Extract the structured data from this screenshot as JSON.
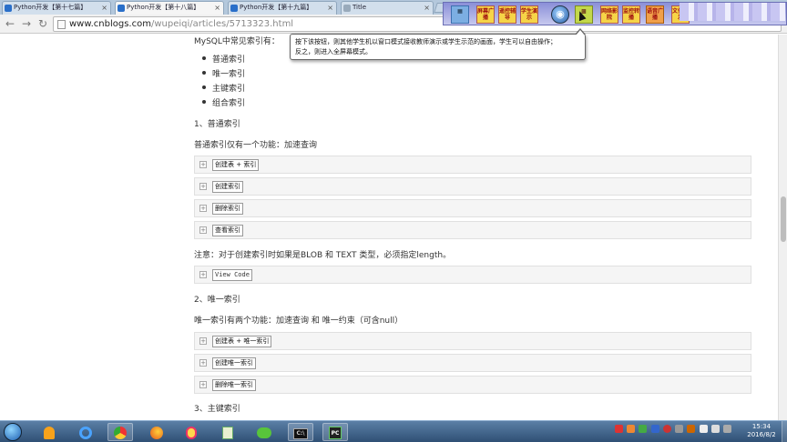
{
  "browser": {
    "tabs": [
      {
        "label": "Python开发【第十七篇】"
      },
      {
        "label": "Python开发【第十八篇】"
      },
      {
        "label": "Python开发【第十九篇】"
      },
      {
        "label": "Title"
      }
    ],
    "close_glyph": "×",
    "url_domain": "www.cnblogs.com",
    "url_path": "/wupeiqi/articles/5713323.html"
  },
  "teaching_toolbar": {
    "buttons": [
      {
        "label": "屏幕广播"
      },
      {
        "label": "遥控辅导"
      },
      {
        "label": "学生演示"
      },
      {
        "label": "网络影院"
      },
      {
        "label": "监控转播"
      },
      {
        "label": "语音广播"
      },
      {
        "label": "文件分发"
      }
    ]
  },
  "tooltip": {
    "line1": "按下该按钮，则其他学生机以窗口模式接收教师演示或学生示范的画面，学生可以自由操作；",
    "line2": "反之，则进入全屏幕模式。"
  },
  "article": {
    "intro": "MySQL中常见索引有：",
    "index_types": [
      "普通索引",
      "唯一索引",
      "主键索引",
      "组合索引"
    ],
    "sec1_title": "1、普通索引",
    "sec1_desc": "普通索引仅有一个功能：加速查询",
    "sec1_blocks": [
      "创建表 + 索引",
      "创建索引",
      "删除索引",
      "查看索引"
    ],
    "note": "注意：对于创建索引时如果是BLOB 和 TEXT 类型，必须指定length。",
    "view_code": "View Code",
    "sec2_title": "2、唯一索引",
    "sec2_desc": "唯一索引有两个功能：加速查询 和 唯一约束（可含null）",
    "sec2_blocks": [
      "创建表 + 唯一索引",
      "创建唯一索引",
      "删除唯一索引"
    ],
    "sec3_title": "3、主键索引"
  },
  "taskbar": {
    "apps": [
      "IE",
      "Chrome",
      "Firefox",
      "QQ",
      "Notepad",
      "WeChat",
      "CMD",
      "PyCharm"
    ],
    "cmd_label": "C:\\",
    "pycharm_label": "PC",
    "clock_time": "15:34",
    "clock_date": "2016/8/2"
  },
  "colors": {
    "taskbar": "#2f5075",
    "tab_strip": "#b4c8dc",
    "teaching_toolbar": "#8a8fd8"
  }
}
